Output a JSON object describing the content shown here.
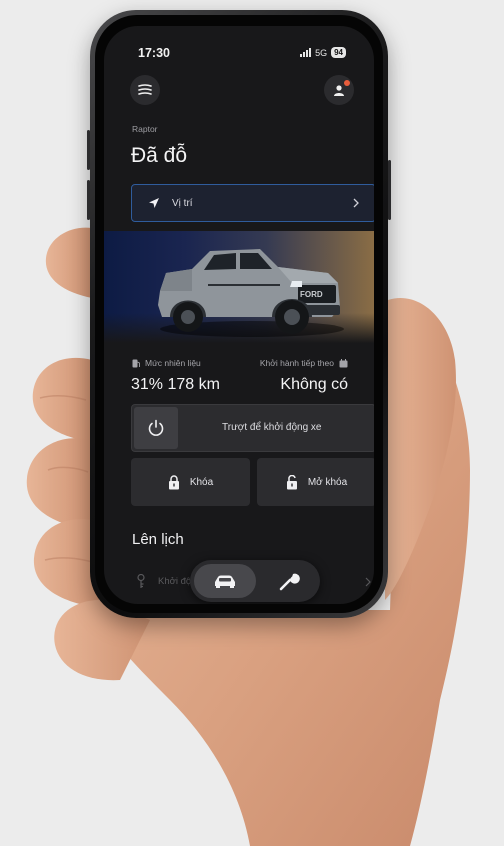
{
  "status_bar": {
    "time": "17:30",
    "network": "5G",
    "battery": "94"
  },
  "header": {
    "vehicle_name": "Raptor",
    "park_status": "Đã đỗ"
  },
  "location": {
    "label": "Vị trí"
  },
  "info": {
    "fuel_label": "Mức nhiên liệu",
    "fuel_value": "31% 178 km",
    "next_trip_label": "Khởi hành tiếp theo",
    "next_trip_value": "Không có"
  },
  "controls": {
    "start_label": "Trượt để khởi động xe",
    "lock_label": "Khóa",
    "unlock_label": "Mở khóa"
  },
  "schedule": {
    "title": "Lên lịch",
    "row_label": "Khởi động xe"
  },
  "icons": {
    "menu": "menu-icon",
    "profile": "profile-icon",
    "location": "location-arrow-icon",
    "power": "power-icon",
    "lock": "lock-icon",
    "unlock": "unlock-icon",
    "nav_car": "car-icon",
    "nav_tools": "wrench-icon"
  },
  "colors": {
    "screen_bg": "#18181a",
    "card_bg": "#2c2c2f",
    "location_border": "#2f5c9c",
    "notification_dot": "#e85d3c"
  }
}
